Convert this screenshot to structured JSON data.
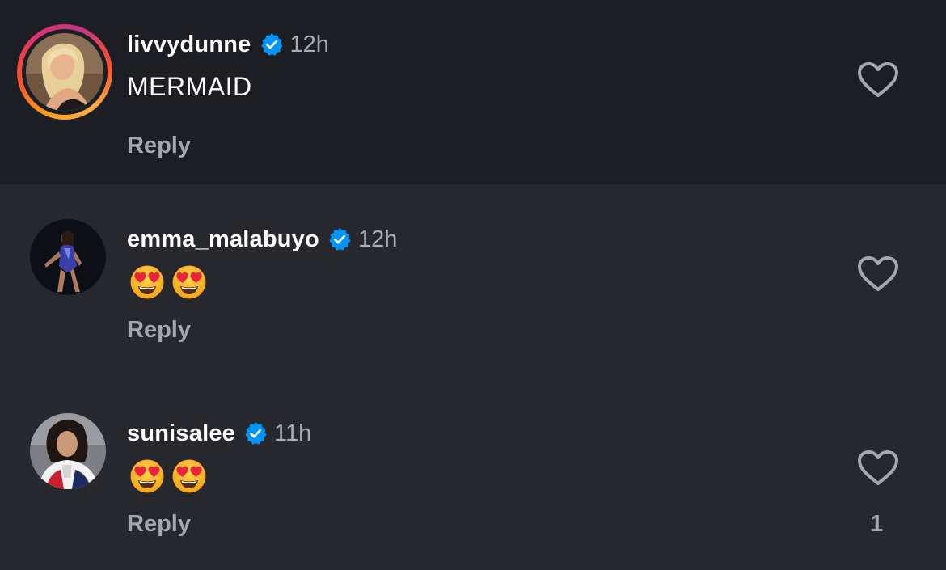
{
  "colors": {
    "background": "#26282e",
    "highlighted_row": "#1c1e23",
    "verified_blue": "#0095f6",
    "secondary_text": "#a8acb5"
  },
  "comments": [
    {
      "username": "livvydunne",
      "verified": true,
      "time": "12h",
      "text": "MERMAID",
      "reply_label": "Reply",
      "like_count": "",
      "has_story_ring": true,
      "avatar": "avatar-blonde-woman"
    },
    {
      "username": "emma_malabuyo",
      "verified": true,
      "time": "12h",
      "emojis": [
        "heart-eyes-emoji",
        "heart-eyes-emoji"
      ],
      "reply_label": "Reply",
      "like_count": "",
      "avatar": "avatar-gymnast"
    },
    {
      "username": "sunisalee",
      "verified": true,
      "time": "11h",
      "emojis": [
        "heart-eyes-emoji",
        "heart-eyes-emoji"
      ],
      "reply_label": "Reply",
      "like_count": "1",
      "avatar": "avatar-woman-jacket"
    }
  ],
  "icons": {
    "like": "heart-outline-icon",
    "verified": "verified-badge-icon"
  }
}
